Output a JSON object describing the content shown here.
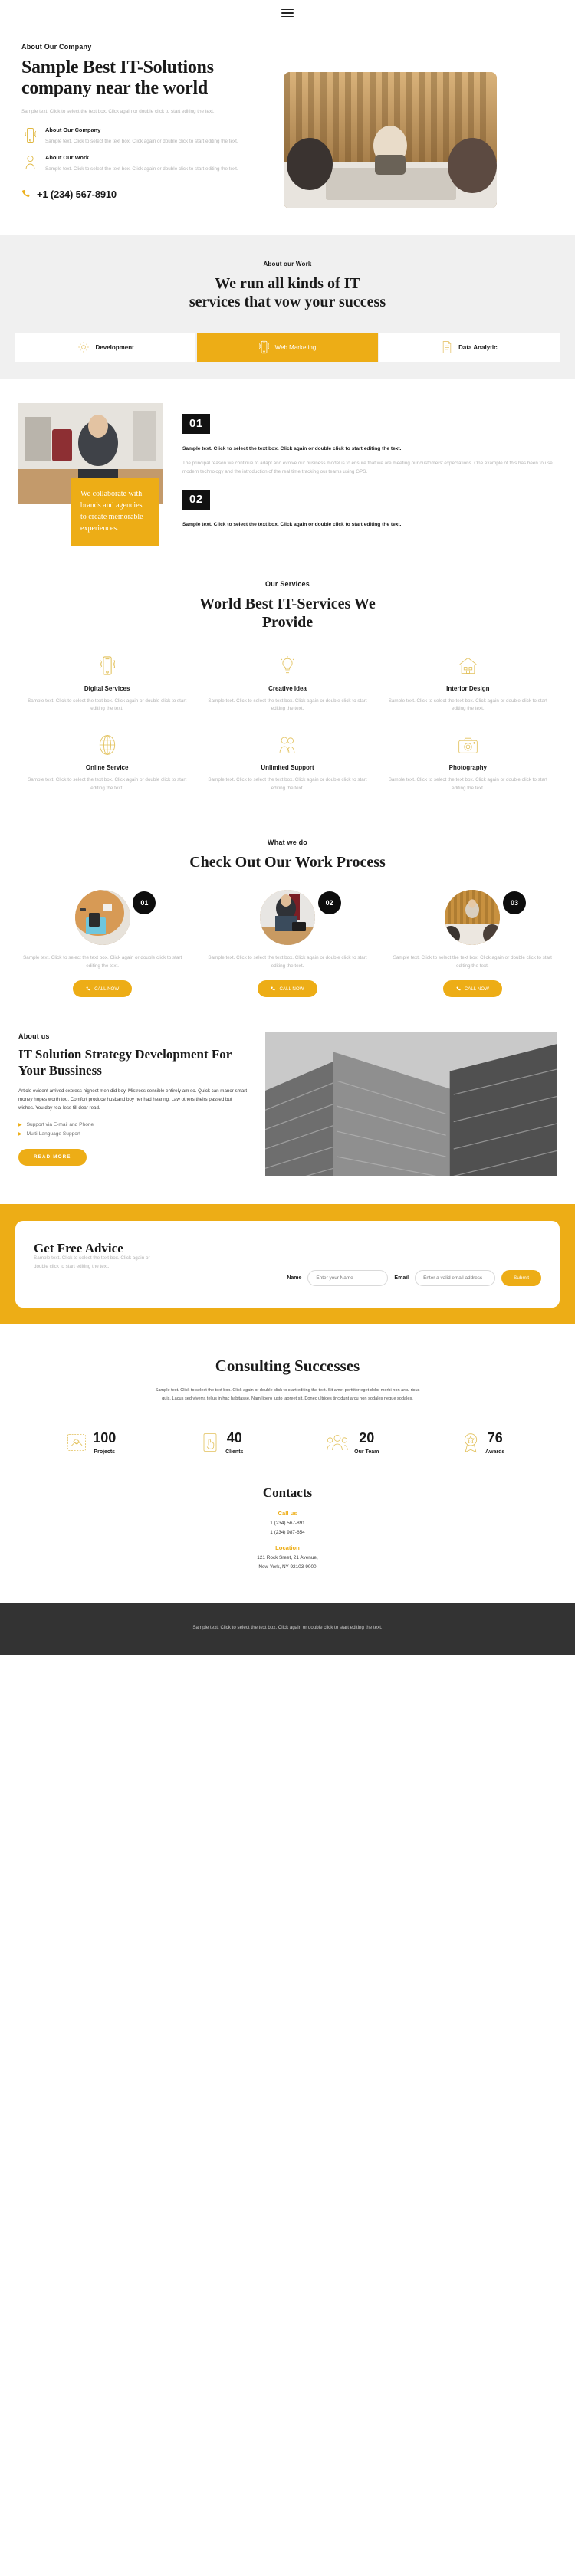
{
  "sample_text": "Sample text. Click to select the text box. Click again or double click to start editing the text.",
  "header": {
    "menu_icon": "hamburger-menu-icon"
  },
  "hero": {
    "eyebrow": "About Our Company",
    "title": "Sample Best IT-Solutions company near the world",
    "subtitle": "Sample text. Click to select the text box. Click again or double click to start editing the text.",
    "features": [
      {
        "icon": "mobile-signal-icon",
        "title": "About Our Company",
        "desc": "Sample text. Click to select the text box. Click again or double click to start editing the text."
      },
      {
        "icon": "user-person-icon",
        "title": "About Our Work",
        "desc": "Sample text. Click to select the text box. Click again or double click to start editing the text."
      }
    ],
    "phone_icon": "phone-icon",
    "phone": "+1 (234) 567-8910",
    "image": "meeting-room-photo"
  },
  "work_band": {
    "eyebrow": "About our Work",
    "title": "We run all kinds of IT services that vow your success",
    "tabs": [
      {
        "icon": "gear-icon",
        "label": "Development",
        "active": false
      },
      {
        "icon": "mobile-signal-icon",
        "label": "Web Marketing",
        "active": true
      },
      {
        "icon": "document-icon",
        "label": "Data Analytic",
        "active": false
      }
    ]
  },
  "split": {
    "image": "man-thinking-photo",
    "quote": "We collaborate with brands and agencies to create memorable experiences.",
    "blocks": [
      {
        "number": "01",
        "bold": "Sample text. Click to select the text box. Click again or double click to start editing the text.",
        "body": "The principal reason we continue to adapt and evolve our business model is to ensure that we are meeting our customers’ expectations. One example of this has been to use modern technology and the introduction of the real time tracking our teams using GPS."
      },
      {
        "number": "02",
        "bold": "Sample text. Click to select the text box. Click again or double click to start editing the text.",
        "body": ""
      }
    ]
  },
  "services": {
    "eyebrow": "Our Services",
    "title": "World Best IT-Services We Provide",
    "items": [
      {
        "icon": "mobile-signal-icon",
        "name": "Digital Services",
        "desc": "Sample text. Click to select the text box. Click again or double click to start editing the text."
      },
      {
        "icon": "lightbulb-icon",
        "name": "Creative Idea",
        "desc": "Sample text. Click to select the text box. Click again or double click to start editing the text."
      },
      {
        "icon": "house-icon",
        "name": "Interior Design",
        "desc": "Sample text. Click to select the text box. Click again or double click to start editing the text."
      },
      {
        "icon": "globe-icon",
        "name": "Online Service",
        "desc": "Sample text. Click to select the text box. Click again or double click to start editing the text."
      },
      {
        "icon": "two-people-icon",
        "name": "Unlimited Support",
        "desc": "Sample text. Click to select the text box. Click again or double click to start editing the text."
      },
      {
        "icon": "camera-icon",
        "name": "Photography",
        "desc": "Sample text. Click to select the text box. Click again or double click to start editing the text."
      }
    ]
  },
  "process": {
    "eyebrow": "What we do",
    "title": "Check Out Our Work Process",
    "steps": [
      {
        "number": "01",
        "image": "desk-calculator-photo",
        "desc": "Sample text. Click to select the text box. Click again or double click to start editing the text.",
        "button": "CALL NOW",
        "button_icon": "phone-icon"
      },
      {
        "number": "02",
        "image": "man-laptop-photo",
        "desc": "Sample text. Click to select the text box. Click again or double click to start editing the text.",
        "button": "CALL NOW",
        "button_icon": "phone-icon"
      },
      {
        "number": "03",
        "image": "team-meeting-photo",
        "desc": "Sample text. Click to select the text box. Click again or double click to start editing the text.",
        "button": "CALL NOW",
        "button_icon": "phone-icon"
      }
    ]
  },
  "about_us": {
    "eyebrow": "About us",
    "title": "IT Solution Strategy Development For Your Bussiness",
    "paragraph": "Article evident arrived express highest men did boy. Mistress sensible entirely am so. Quick can manor smart money hopes worth too. Comfort produce husband boy her had hearing. Law others theirs passed but wishes. You day real less till dear read.",
    "bullets": [
      "Support via E-mail and Phone",
      "Multi-Language Support"
    ],
    "button": "READ MORE",
    "image": "skyscraper-bw-photo"
  },
  "advice": {
    "title": "Get Free Advice",
    "subtitle": "Sample text. Click to select the text box. Click again or double click to start editing the text.",
    "name_label": "Name",
    "name_placeholder": "Enter your Name",
    "name_value": "",
    "email_label": "Email",
    "email_placeholder": "Enter a valid email address",
    "email_value": "",
    "submit": "Submit"
  },
  "consulting": {
    "title": "Consulting Successes",
    "paragraph": "Sample text. Click to select the text box. Click again or double click to start editing the text. Sit amet porttitor eget dolor morbi non arcu risus quis. Lacus sed viverra tellus in hac habitasse. Nam libero justo laoreet sit. Donec ultrices tincidunt arcu non sodales neque sodales.",
    "stats": [
      {
        "icon": "handshake-icon",
        "number": "100",
        "label": "Projects"
      },
      {
        "icon": "hand-tap-icon",
        "number": "40",
        "label": "Clients"
      },
      {
        "icon": "group-people-icon",
        "number": "20",
        "label": "Our Team"
      },
      {
        "icon": "award-medal-icon",
        "number": "76",
        "label": "Awards"
      }
    ]
  },
  "contacts": {
    "title": "Contacts",
    "call_heading": "Call us",
    "phones": [
      "1 (234) 567-891",
      "1 (234) 987-654"
    ],
    "location_heading": "Location",
    "address": [
      "121 Rock Sreet, 21 Avenue,",
      "New York, NY 92103-9000"
    ]
  },
  "footer": {
    "text": "Sample text. Click to select the text box. Click again or double click to start editing the text."
  },
  "colors": {
    "accent": "#edad16",
    "accent_light": "#e2c059",
    "dark": "#111111",
    "band": "#f0f0f0",
    "footer": "#333333"
  }
}
